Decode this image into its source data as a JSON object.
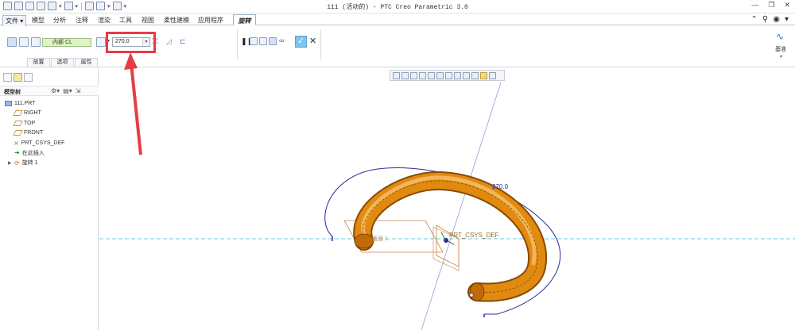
{
  "title": "111 (活动的) - PTC Creo Parametric 3.0",
  "menu": {
    "file": "文件",
    "tabs": [
      "模型",
      "分析",
      "注释",
      "渲染",
      "工具",
      "视图",
      "柔性建模",
      "应用程序"
    ],
    "active_tab": "旋转"
  },
  "ribbon": {
    "axis_value": "内部 CL",
    "angle_value": "270.0",
    "subtabs": [
      "放置",
      "选项",
      "属性"
    ],
    "datum_label": "基准"
  },
  "model_tree": {
    "title": "模型树",
    "items": [
      {
        "label": "111.PRT",
        "icon": "part-icon"
      },
      {
        "label": "RIGHT",
        "icon": "datum-plane-icon"
      },
      {
        "label": "TOP",
        "icon": "datum-plane-icon"
      },
      {
        "label": "FRONT",
        "icon": "datum-plane-icon"
      },
      {
        "label": "PRT_CSYS_DEF",
        "icon": "csys-icon"
      },
      {
        "label": "在此插入",
        "icon": "insert-here-icon"
      },
      {
        "label": "旋转 1",
        "icon": "revolve-icon"
      }
    ]
  },
  "graphics": {
    "dimension_label": "270.0",
    "csys_label": "PRT_CSYS_DEF",
    "section_label": "截面 1"
  },
  "colors": {
    "highlight": "#e73c46",
    "model": "#e08a10",
    "dimension": "#2a2aa0",
    "axis": "#5fd0e6"
  }
}
